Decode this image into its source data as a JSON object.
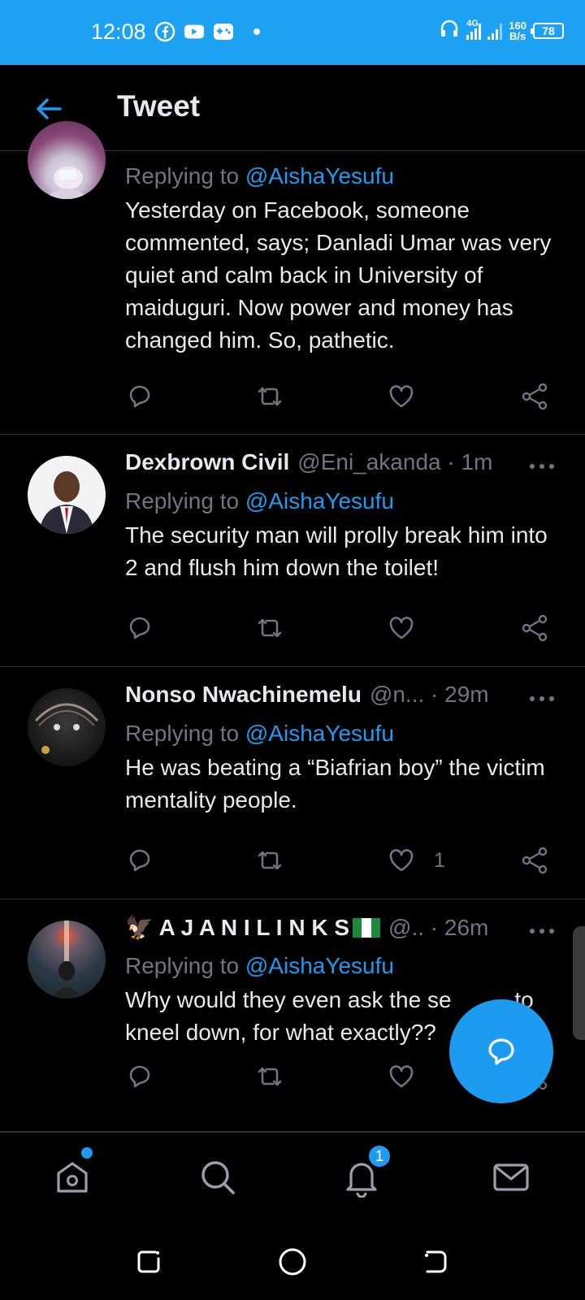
{
  "status_bar": {
    "time": "12:08",
    "network_type": "4G",
    "speed_value": "160",
    "speed_unit": "B/s",
    "battery": "78"
  },
  "header": {
    "title": "Tweet"
  },
  "tweets": [
    {
      "name": "",
      "handle": "",
      "replying_prefix": "Replying to",
      "mention": "@AishaYesufu",
      "body": "Yesterday on Facebook, someone commented, says; Danladi Umar was very quiet and calm back in University of maiduguri. Now power and money has changed him. So, pathetic.",
      "like_count": ""
    },
    {
      "name": "Dexbrown Civil",
      "handle": "@Eni_akanda · 1m",
      "replying_prefix": "Replying to",
      "mention": "@AishaYesufu",
      "body": "The security man will prolly break him into 2 and flush him down the toilet!",
      "like_count": ""
    },
    {
      "name": "Nonso Nwachinemelu",
      "handle": "@n... · 29m",
      "replying_prefix": "Replying to",
      "mention": "@AishaYesufu",
      "body": "He was beating a “Biafrian boy” the victim mentality people.",
      "like_count": "1"
    },
    {
      "name": "🦅 A J A N I L I N K S",
      "handle": "@.. · 26m",
      "replying_prefix": "Replying to",
      "mention": "@AishaYesufu",
      "body": "Why would they even ask the se          to kneel down, for what exactly??",
      "like_count": ""
    }
  ],
  "bottom_nav": {
    "notifications_badge": "1"
  },
  "icons": {
    "brand": "#1da1f2",
    "accent": "#1d9bf0",
    "muted": "#71767b"
  }
}
